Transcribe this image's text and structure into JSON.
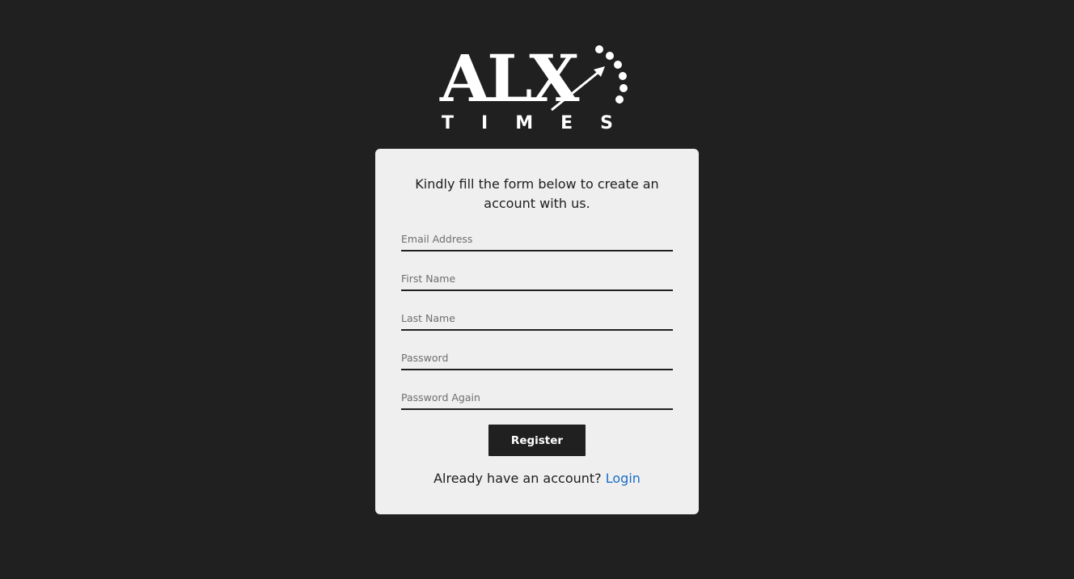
{
  "logo": {
    "main": "ALX",
    "sub": "TIMES",
    "icon": "arrow-dots-logo-icon"
  },
  "form": {
    "intro": "Kindly fill the form below to create an account with us.",
    "fields": [
      {
        "placeholder": "Email Address",
        "value": ""
      },
      {
        "placeholder": "First Name",
        "value": ""
      },
      {
        "placeholder": "Last Name",
        "value": ""
      },
      {
        "placeholder": "Password",
        "value": ""
      },
      {
        "placeholder": "Password Again",
        "value": ""
      }
    ],
    "register_label": "Register",
    "login_prompt": "Already have an account?",
    "login_label": "Login"
  },
  "colors": {
    "background": "#202020",
    "card": "#efefef",
    "link": "#1a6dc8",
    "button": "#202020"
  }
}
